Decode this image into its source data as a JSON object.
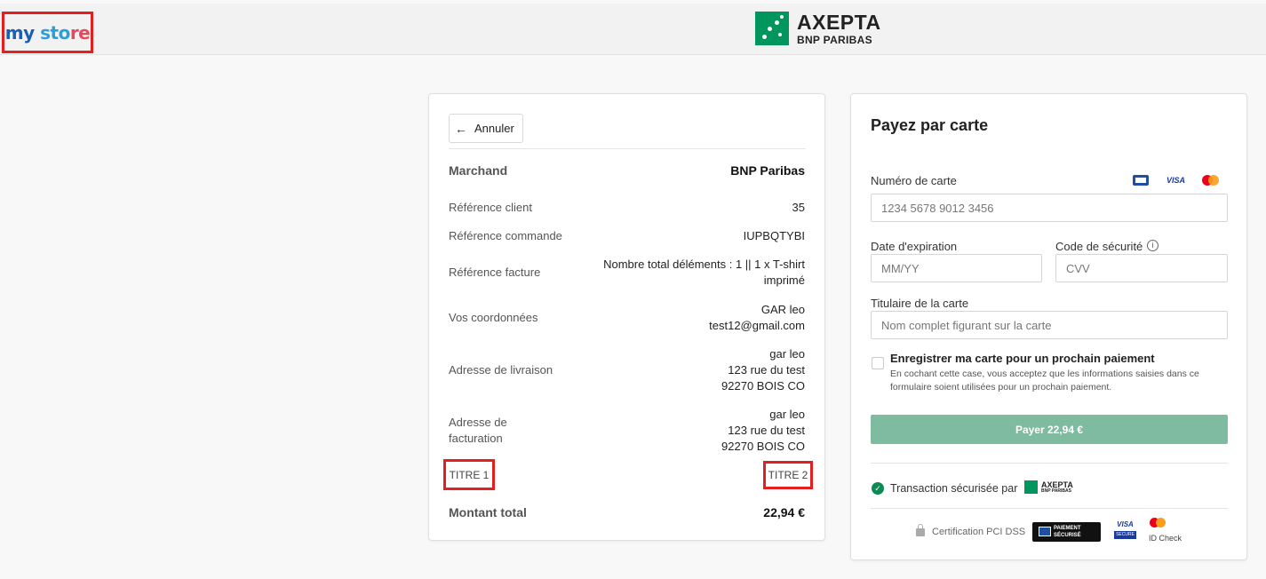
{
  "header": {
    "logo": {
      "part1": "my",
      "part2": " sto",
      "part3": "re"
    },
    "brand_title": "AXEPTA",
    "brand_subtitle": "BNP PARIBAS"
  },
  "summary": {
    "cancel_label": "Annuler",
    "merchant_label": "Marchand",
    "merchant_value": "BNP Paribas",
    "client_ref_label": "Référence client",
    "client_ref_value": "35",
    "order_ref_label": "Référence commande",
    "order_ref_value": "IUPBQTYBI",
    "invoice_ref_label": "Référence facture",
    "invoice_ref_value_1": "Nombre total déléments : 1 || 1 x T-shirt",
    "invoice_ref_value_2": "imprimé",
    "contact_label": "Vos coordonnées",
    "contact_value_1": "GAR leo",
    "contact_value_2": "test12@gmail.com",
    "shipping_label": "Adresse de livraison",
    "shipping_value_1": "gar leo",
    "shipping_value_2": "123 rue du test",
    "shipping_value_3": "92270 BOIS CO",
    "billing_label_1": "Adresse de",
    "billing_label_2": "facturation",
    "billing_value_1": "gar leo",
    "billing_value_2": "123 rue du test",
    "billing_value_3": "92270 BOIS CO",
    "title1": "TITRE 1",
    "title2": "TITRE 2",
    "total_label": "Montant total",
    "total_value": "22,94 €"
  },
  "payment": {
    "title": "Payez par carte",
    "card_number_label": "Numéro de carte",
    "card_number_placeholder": "1234 5678 9012 3456",
    "visa_text": "VISA",
    "expiry_label": "Date d'expiration",
    "expiry_placeholder": "MM/YY",
    "cvv_label": "Code de sécurité",
    "cvv_placeholder": "CVV",
    "holder_label": "Titulaire de la carte",
    "holder_placeholder": "Nom complet figurant sur la carte",
    "save_title": "Enregistrer ma carte pour un prochain paiement",
    "save_desc": "En cochant cette case, vous acceptez que les informations saisies dans ce formulaire soient utilisées pour un prochain paiement.",
    "pay_button": "Payer 22,94 €",
    "secured_text": "Transaction sécurisée par",
    "mini_brand_title": "AXEPTA",
    "mini_brand_subtitle": "BNP PARIBAS",
    "pci_text": "Certification PCI DSS",
    "badge_line1": "PAIEMENT",
    "badge_line2": "SÉCURISÉ",
    "visa_secure_v": "VISA",
    "visa_secure_b": "SECURE",
    "id_check": "ID Check"
  },
  "colors": {
    "brand_green": "#00965e",
    "pay_button": "#7fbba0",
    "highlight_red": "#e41f1f"
  }
}
